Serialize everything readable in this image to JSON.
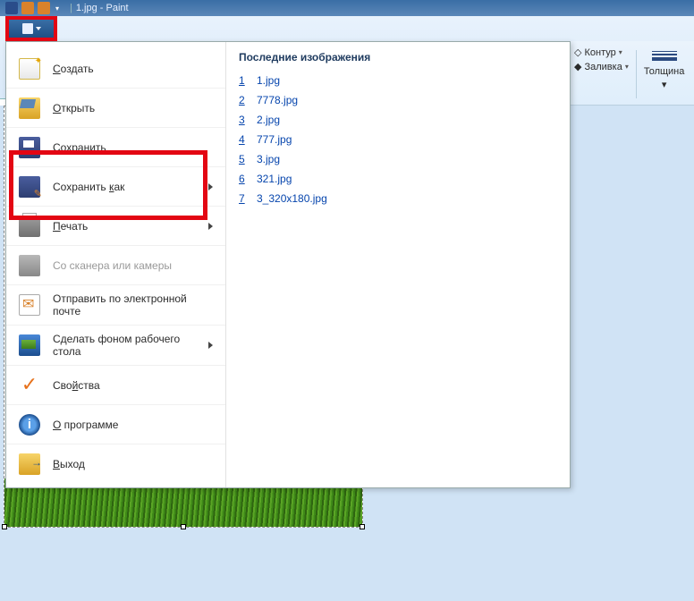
{
  "title": {
    "filename": "1.jpg",
    "app": "Paint"
  },
  "ribbon": {
    "outline": "Контур",
    "fill": "Заливка",
    "thickness": "Толщина"
  },
  "file_menu": {
    "new": "Создать",
    "open": "Открыть",
    "save": "Сохранить",
    "save_as": "Сохранить как",
    "print": "Печать",
    "scanner": "Со сканера или камеры",
    "email": "Отправить по электронной почте",
    "wallpaper": "Сделать фоном рабочего стола",
    "properties": "Свойства",
    "about": "О программе",
    "exit": "Выход"
  },
  "recent": {
    "title": "Последние изображения",
    "items": [
      {
        "n": "1",
        "name": "1.jpg"
      },
      {
        "n": "2",
        "name": "7778.jpg"
      },
      {
        "n": "3",
        "name": "2.jpg"
      },
      {
        "n": "4",
        "name": "777.jpg"
      },
      {
        "n": "5",
        "name": "3.jpg"
      },
      {
        "n": "6",
        "name": "321.jpg"
      },
      {
        "n": "7",
        "name": "3_320x180.jpg"
      }
    ]
  }
}
